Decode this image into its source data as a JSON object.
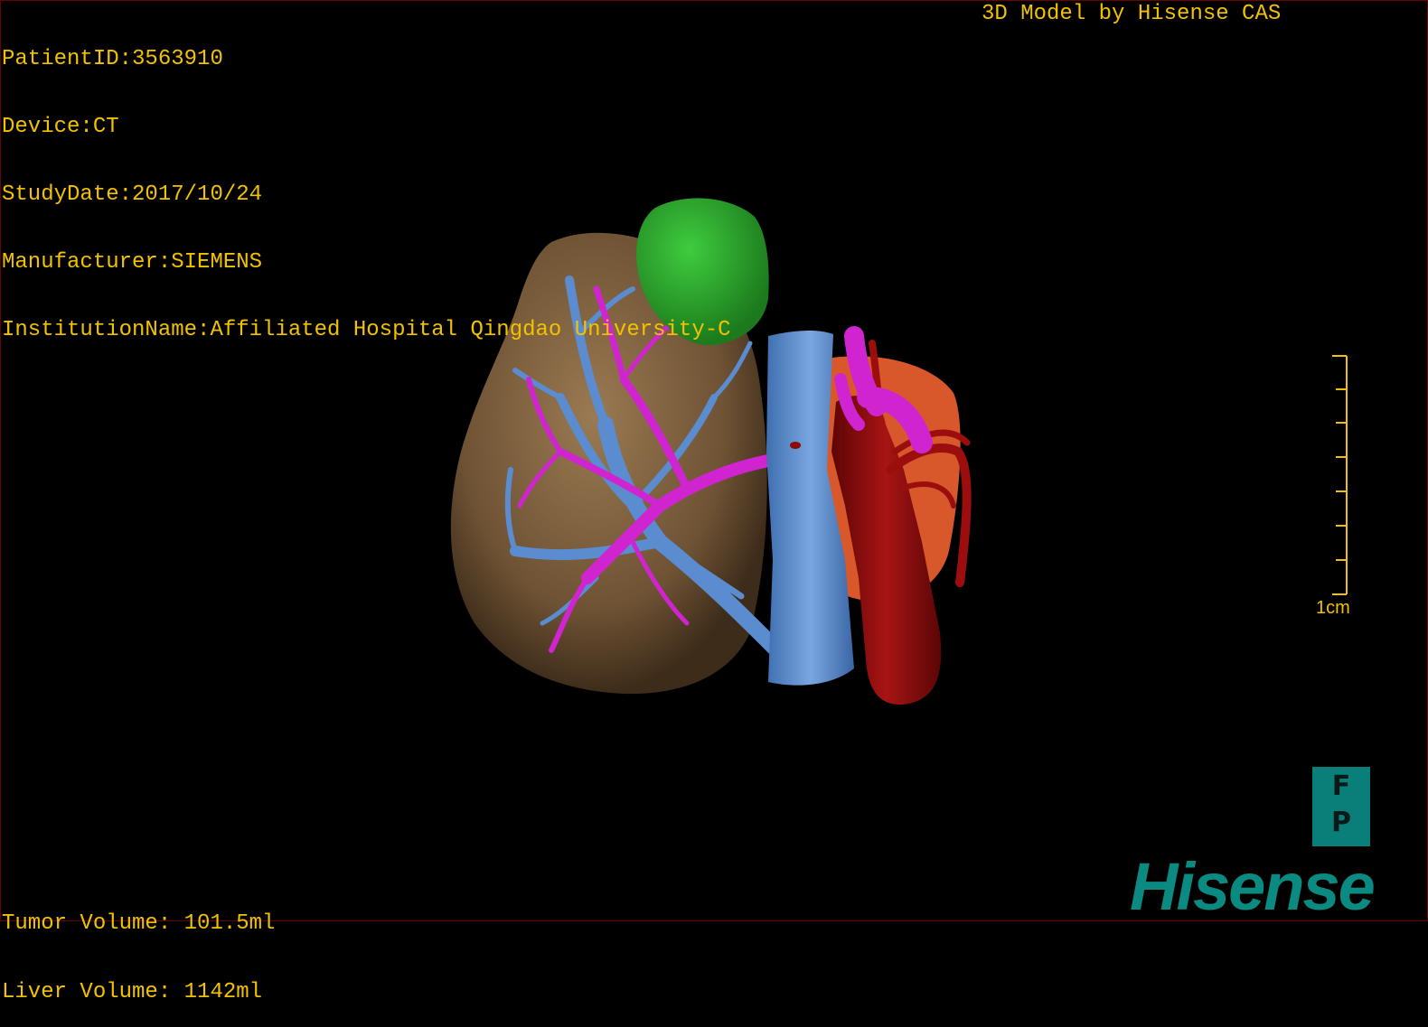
{
  "header": {
    "patient_id": "PatientID:3563910",
    "device": "Device:CT",
    "study_date": "StudyDate:2017/10/24",
    "manufacturer": "Manufacturer:SIEMENS",
    "institution": "InstitutionName:Affiliated Hospital Qingdao University-C",
    "model_credit": "3D Model by Hisense CAS"
  },
  "scale_bar": {
    "label": "1cm"
  },
  "orientation_cube": {
    "top": "F",
    "bottom": "P"
  },
  "volumes": {
    "tumor": "Tumor Volume: 101.5ml",
    "liver": "Liver Volume: 1142ml"
  },
  "logo": {
    "text": "Hisense"
  },
  "colors": {
    "overlay_text": "#f2c200",
    "liver": "#7a5a3a",
    "tumor": "#2ea82e",
    "portal_vein": "#5a8ccf",
    "hepatic_artery": "#cc22cc",
    "aorta": "#8b0a0a",
    "kidney": "#d9582e",
    "logo": "#0a8a80"
  }
}
